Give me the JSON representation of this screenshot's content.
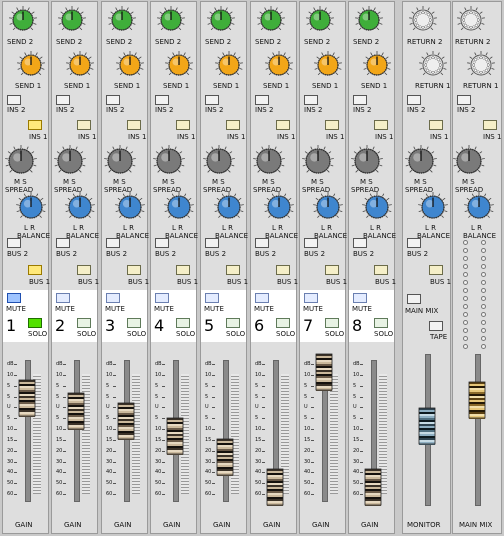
{
  "channels": [
    {
      "number": "1",
      "send2": "SEND 2",
      "send1": "SEND 1",
      "ins2": "INS 2",
      "ins1": "INS 1",
      "ins1_on": true,
      "spread": "SPREAD",
      "ms": "M  S",
      "balance": "BALANCE",
      "lr": "L  R",
      "bus2": "BUS 2",
      "bus1": "BUS 1",
      "bus1_on": true,
      "mute": "MUTE",
      "mute_on": true,
      "solo": "SOLO",
      "solo_on": true,
      "gain": "GAIN",
      "fader_level": 0.72
    },
    {
      "number": "2",
      "send2": "SEND 2",
      "send1": "SEND 1",
      "ins2": "INS 2",
      "ins1": "INS 1",
      "ins1_on": false,
      "spread": "SPREAD",
      "ms": "M  S",
      "balance": "BALANCE",
      "lr": "L  R",
      "bus2": "BUS 2",
      "bus1": "BUS 1",
      "bus1_on": false,
      "mute": "MUTE",
      "mute_on": false,
      "solo": "SOLO",
      "solo_on": false,
      "gain": "GAIN",
      "fader_level": 0.62
    },
    {
      "number": "3",
      "send2": "SEND 2",
      "send1": "SEND 1",
      "ins2": "INS 2",
      "ins1": "INS 1",
      "ins1_on": false,
      "spread": "SPREAD",
      "ms": "M  S",
      "balance": "BALANCE",
      "lr": "L  R",
      "bus2": "BUS 2",
      "bus1": "BUS 1",
      "bus1_on": false,
      "mute": "MUTE",
      "mute_on": false,
      "solo": "SOLO",
      "solo_on": false,
      "gain": "GAIN",
      "fader_level": 0.55
    },
    {
      "number": "4",
      "send2": "SEND 2",
      "send1": "SEND 1",
      "ins2": "INS 2",
      "ins1": "INS 1",
      "ins1_on": false,
      "spread": "SPREAD",
      "ms": "M  S",
      "balance": "BALANCE",
      "lr": "L  R",
      "bus2": "BUS 2",
      "bus1": "BUS 1",
      "bus1_on": false,
      "mute": "MUTE",
      "mute_on": false,
      "solo": "SOLO",
      "solo_on": false,
      "gain": "GAIN",
      "fader_level": 0.43
    },
    {
      "number": "5",
      "send2": "SEND 2",
      "send1": "SEND 1",
      "ins2": "INS 2",
      "ins1": "INS 1",
      "ins1_on": false,
      "spread": "SPREAD",
      "ms": "M  S",
      "balance": "BALANCE",
      "lr": "L  R",
      "bus2": "BUS 2",
      "bus1": "BUS 1",
      "bus1_on": false,
      "mute": "MUTE",
      "mute_on": false,
      "solo": "SOLO",
      "solo_on": false,
      "gain": "GAIN",
      "fader_level": 0.27
    },
    {
      "number": "6",
      "send2": "SEND 2",
      "send1": "SEND 1",
      "ins2": "INS 2",
      "ins1": "INS 1",
      "ins1_on": false,
      "spread": "SPREAD",
      "ms": "M  S",
      "balance": "BALANCE",
      "lr": "L  R",
      "bus2": "BUS 2",
      "bus1": "BUS 1",
      "bus1_on": false,
      "mute": "MUTE",
      "mute_on": false,
      "solo": "SOLO",
      "solo_on": false,
      "gain": "GAIN",
      "fader_level": 0.04
    },
    {
      "number": "7",
      "send2": "SEND 2",
      "send1": "SEND 1",
      "ins2": "INS 2",
      "ins1": "INS 1",
      "ins1_on": false,
      "spread": "SPREAD",
      "ms": "M  S",
      "balance": "BALANCE",
      "lr": "L  R",
      "bus2": "BUS 2",
      "bus1": "BUS 1",
      "bus1_on": false,
      "mute": "MUTE",
      "mute_on": false,
      "solo": "SOLO",
      "solo_on": false,
      "gain": "GAIN",
      "fader_level": 0.92
    },
    {
      "number": "8",
      "send2": "SEND 2",
      "send1": "SEND 1",
      "ins2": "INS 2",
      "ins1": "INS 1",
      "ins1_on": false,
      "spread": "SPREAD",
      "ms": "M  S",
      "balance": "BALANCE",
      "lr": "L  R",
      "bus2": "BUS 2",
      "bus1": "BUS 1",
      "bus1_on": false,
      "mute": "MUTE",
      "mute_on": false,
      "solo": "SOLO",
      "solo_on": false,
      "gain": "GAIN",
      "fader_level": 0.04
    }
  ],
  "monitor": {
    "return2": "RETURN 2",
    "return1": "RETURN 1",
    "ins2": "INS 2",
    "ins1": "INS 1",
    "spread": "SPREAD",
    "ms": "M  S",
    "balance": "BALANCE",
    "lr": "L  R",
    "bus2": "BUS 2",
    "bus1": "BUS 1",
    "main_mix": "MAIN MIX",
    "tape": "TAPE",
    "label": "MONITOR",
    "fader_level": 0.52
  },
  "main": {
    "return2": "RETURN 2",
    "return1": "RETURN 1",
    "ins2": "INS 2",
    "ins1": "INS 1",
    "spread": "SPREAD",
    "ms": "M  S",
    "balance": "BALANCE",
    "lr": "L  R",
    "label": "MAIN MIX",
    "fader_level": 0.78
  },
  "fader_scale": [
    "dB",
    "10",
    "5",
    "5",
    "U",
    "5",
    "10",
    "15",
    "20",
    "30",
    "40",
    "50",
    "60"
  ],
  "fader_scale_full": [
    "dB",
    "10",
    "5",
    "U",
    "5",
    "10",
    "15",
    "20",
    "25",
    "30",
    "35",
    "40",
    "45",
    "50",
    "60"
  ],
  "colors": {
    "send2_knob": "#3fae3a",
    "send1_knob": "#f2a618",
    "balance_knob": "#3f86cf",
    "spread_knob": "#7a7a7a",
    "mute_on": "#9fc4ff",
    "solo_on": "#52e000",
    "ins_on": "#ffe97a"
  },
  "icons": {
    "knob": "rotary-knob-icon",
    "fader": "fader-cap-icon"
  }
}
